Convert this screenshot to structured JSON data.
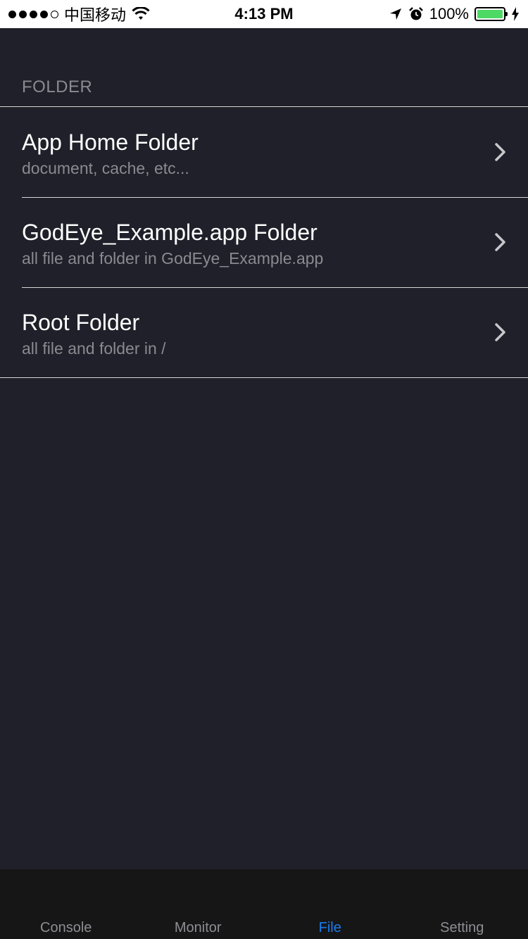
{
  "status_bar": {
    "carrier": "中国移动",
    "time": "4:13 PM",
    "battery": "100%"
  },
  "section": {
    "header": "FOLDER"
  },
  "rows": [
    {
      "title": "App Home Folder",
      "subtitle": "document, cache, etc..."
    },
    {
      "title": "GodEye_Example.app Folder",
      "subtitle": "all file and folder in GodEye_Example.app"
    },
    {
      "title": "Root Folder",
      "subtitle": "all file and folder in /"
    }
  ],
  "tabs": [
    {
      "label": "Console"
    },
    {
      "label": "Monitor"
    },
    {
      "label": "File"
    },
    {
      "label": "Setting"
    }
  ],
  "colors": {
    "background": "#1f2029",
    "tab_bar": "#161616",
    "active_tab": "#1a7cf0",
    "battery": "#4cd964"
  }
}
